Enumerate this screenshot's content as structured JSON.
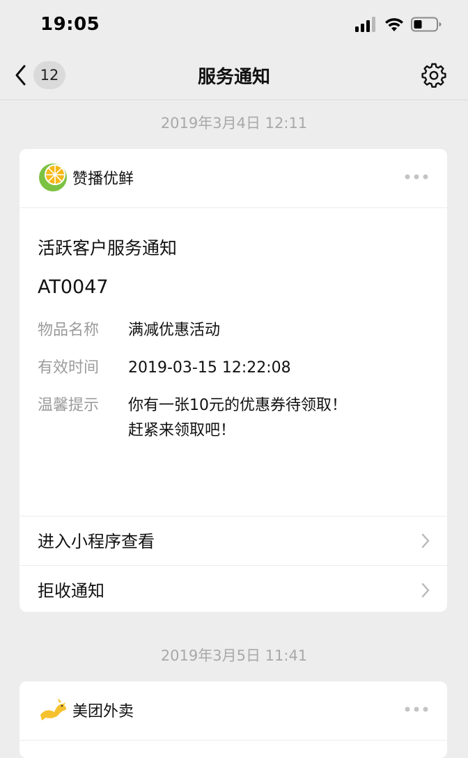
{
  "status_bar": {
    "time": "19:05"
  },
  "nav": {
    "back_count": "12",
    "title": "服务通知"
  },
  "notifications": [
    {
      "date": "2019年3月4日 12:11",
      "app_name": "赞播优鲜",
      "title": "活跃客户服务通知",
      "code": "AT0047",
      "fields": [
        {
          "label": "物品名称",
          "value": "满减优惠活动"
        },
        {
          "label": "有效时间",
          "value": "2019-03-15 12:22:08"
        },
        {
          "label": "温馨提示",
          "value_lines": [
            "你有一张10元的优惠券待领取！",
            "赶紧来领取吧！"
          ]
        }
      ],
      "actions": [
        "进入小程序查看",
        "拒收通知"
      ]
    },
    {
      "date": "2019年3月5日 11:41",
      "app_name": "美团外卖"
    }
  ],
  "colors": {
    "background": "#ededed",
    "card": "#ffffff",
    "muted_text": "#9b9b9b",
    "date_text": "#a8a8a8",
    "lemon_green": "#7cc242",
    "lemon_yellow": "#f5b917",
    "meituan_yellow": "#f6c12e"
  },
  "icons": {
    "back": "chevron-left-icon",
    "settings": "gear-icon",
    "more": "more-dots-icon",
    "action_arrow": "chevron-right-icon",
    "signal": "cellular-signal-icon",
    "wifi": "wifi-icon",
    "battery": "battery-icon"
  }
}
